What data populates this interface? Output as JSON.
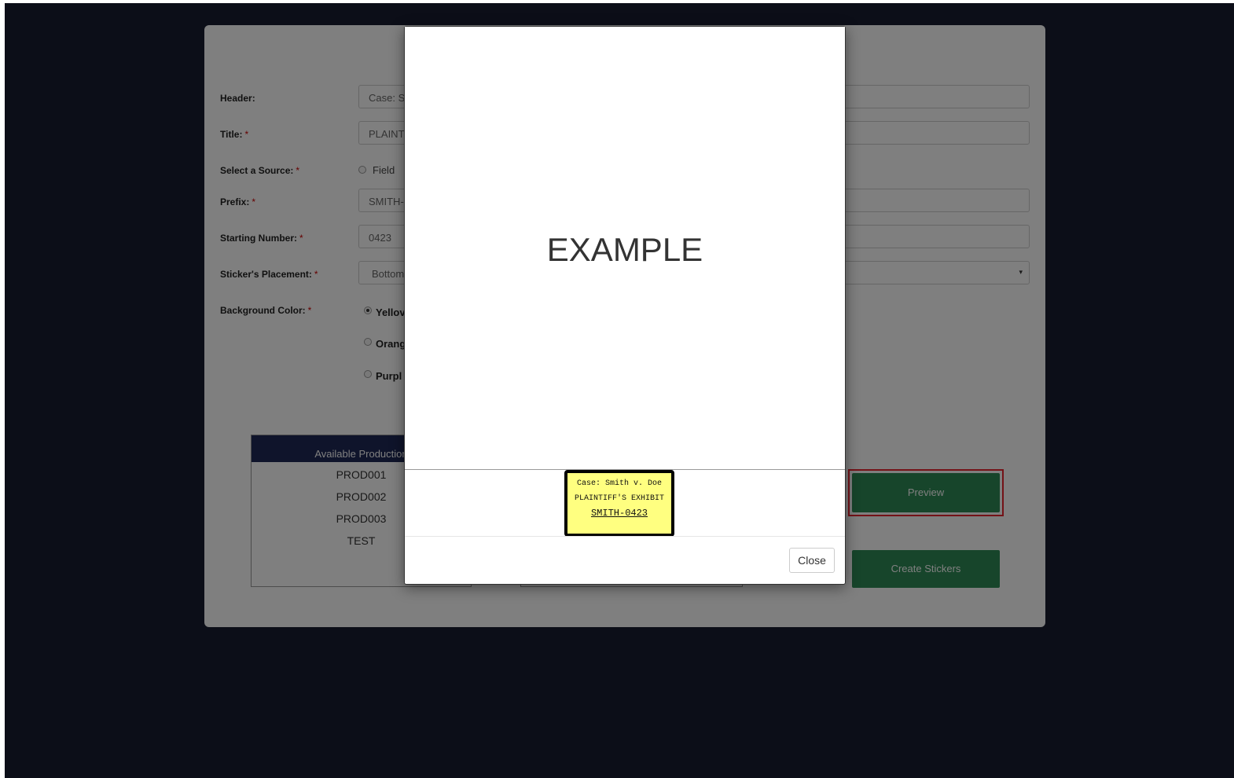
{
  "form": {
    "header_label": "Header:",
    "header_value": "Case: S",
    "title_label": "Title:",
    "title_value": "PLAINT",
    "source_label": "Select a Source:",
    "source_option_field": "Field",
    "prefix_label": "Prefix:",
    "prefix_value": "SMITH-",
    "starting_number_label": "Starting Number:",
    "starting_number_value": "0423",
    "placement_label": "Sticker's Placement:",
    "placement_value": "Bottom",
    "bg_color_label": "Background Color:",
    "color_yellow": "Yellov",
    "color_orange": "Orang",
    "color_purple": "Purpl",
    "required_mark": "*"
  },
  "productions": {
    "header": "Available Production",
    "items": [
      "PROD001",
      "PROD002",
      "PROD003",
      "TEST"
    ]
  },
  "buttons": {
    "preview": "Preview",
    "create_stickers": "Create Stickers"
  },
  "modal": {
    "example_text": "EXAMPLE",
    "sticker_line1": "Case: Smith v. Doe",
    "sticker_line2": "PLAINTIFF'S EXHIBIT",
    "sticker_line3": "SMITH-0423",
    "close": "Close"
  },
  "colors": {
    "page_bg": "#181c30",
    "accent_green": "#2e8b57",
    "list_header": "#1e2857",
    "highlight": "#e8242e",
    "sticker_yellow": "#ffff80"
  },
  "icons": {
    "dropdown": "▾"
  }
}
